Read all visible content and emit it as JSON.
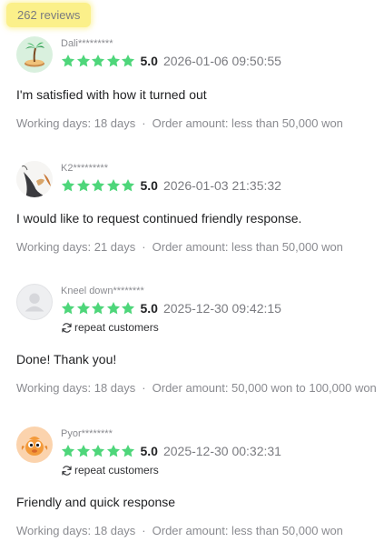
{
  "summary": {
    "count_label": "262 reviews"
  },
  "labels": {
    "repeat_customers": "repeat customers"
  },
  "reviews": [
    {
      "nickname": "Dali*********",
      "avatar": "palm-tree-island",
      "score": "5.0",
      "date": "2026-01-06 09:50:55",
      "repeat": false,
      "text": "I'm satisfied with how it turned out",
      "working_days": "Working days: 18 days",
      "order_amount": "Order amount: less than 50,000 won"
    },
    {
      "nickname": "K2*********",
      "avatar": "bird-photo",
      "score": "5.0",
      "date": "2026-01-03 21:35:32",
      "repeat": false,
      "text": "I would like to request continued friendly response.",
      "working_days": "Working days: 21 days",
      "order_amount": "Order amount: less than 50,000 won"
    },
    {
      "nickname": "Kneel down********",
      "avatar": "default-user",
      "score": "5.0",
      "date": "2025-12-30 09:42:15",
      "repeat": true,
      "text": "Done! Thank you!",
      "working_days": "Working days: 18 days",
      "order_amount": "Order amount: 50,000 won to 100,000 won"
    },
    {
      "nickname": "Pyor********",
      "avatar": "orange-fish",
      "score": "5.0",
      "date": "2025-12-30 00:32:31",
      "repeat": true,
      "text": "Friendly and quick response",
      "working_days": "Working days: 18 days",
      "order_amount": "Order amount: less than 50,000 won"
    }
  ],
  "colors": {
    "star": "#4ed67a",
    "badge_bg": "#fbf08a"
  },
  "separator": "·"
}
